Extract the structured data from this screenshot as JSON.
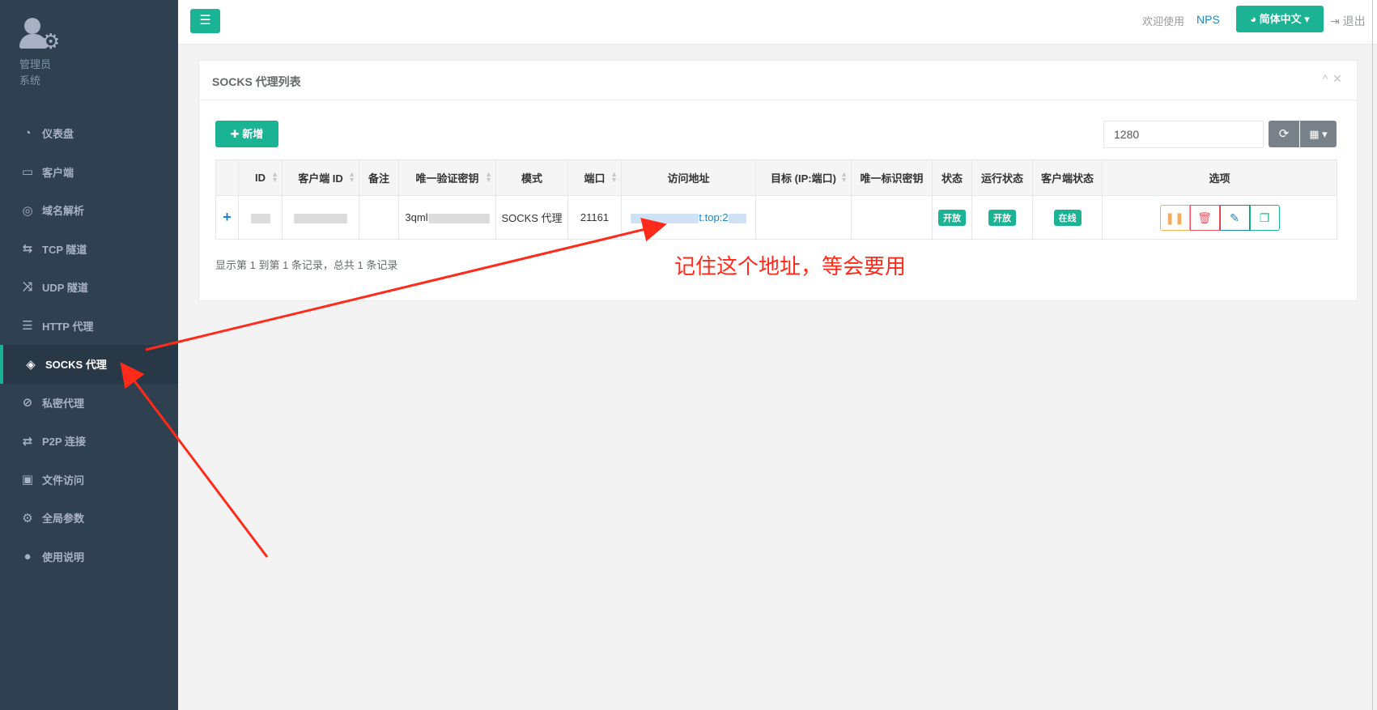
{
  "sidebar": {
    "profile": {
      "role": "管理员",
      "name": "系统"
    },
    "items": [
      {
        "icon": "dashboard-icon",
        "glyph": "◔",
        "label": "仪表盘",
        "active": false
      },
      {
        "icon": "desktop-icon",
        "glyph": "▭",
        "label": "客户端",
        "active": false
      },
      {
        "icon": "globe-icon",
        "glyph": "◎",
        "label": "域名解析",
        "active": false
      },
      {
        "icon": "retweet-icon",
        "glyph": "⇆",
        "label": "TCP 隧道",
        "active": false
      },
      {
        "icon": "random-icon",
        "glyph": "⤨",
        "label": "UDP 隧道",
        "active": false
      },
      {
        "icon": "server-icon",
        "glyph": "☰",
        "label": "HTTP 代理",
        "active": false
      },
      {
        "icon": "layers-icon",
        "glyph": "◈",
        "label": "SOCKS 代理",
        "active": true
      },
      {
        "icon": "eye-slash-icon",
        "glyph": "⊘",
        "label": "私密代理",
        "active": false
      },
      {
        "icon": "exchange-icon",
        "glyph": "⇄",
        "label": "P2P 连接",
        "active": false
      },
      {
        "icon": "briefcase-icon",
        "glyph": "▣",
        "label": "文件访问",
        "active": false
      },
      {
        "icon": "gear-icon",
        "glyph": "⚙",
        "label": "全局参数",
        "active": false
      },
      {
        "icon": "lightbulb-icon",
        "glyph": "●",
        "label": "使用说明",
        "active": false
      }
    ]
  },
  "topbar": {
    "welcome": "欢迎使用",
    "brand": "NPS",
    "language": "简体中文",
    "logout": "退出"
  },
  "panel": {
    "title": "SOCKS 代理列表",
    "add_label": "新增",
    "search_value": "1280",
    "columns": [
      "ID",
      "客户端 ID",
      "备注",
      "唯一验证密钥",
      "模式",
      "端口",
      "访问地址",
      "目标 (IP:端口)",
      "唯一标识密钥",
      "状态",
      "运行状态",
      "客户端状态",
      "选项"
    ],
    "row": {
      "key_prefix": "3qml",
      "mode": "SOCKS 代理",
      "port": "21161",
      "address_suffix": "t.top:2",
      "status": "开放",
      "run_status": "开放",
      "client_status": "在线"
    },
    "pager": "显示第 1 到第 1 条记录，总共 1 条记录"
  },
  "annotation": "记住这个地址，等会要用",
  "colors": {
    "accent": "#1ab394",
    "sidebar": "#2f4050",
    "link": "#1c84c6",
    "annotation": "#ff2a1a"
  }
}
